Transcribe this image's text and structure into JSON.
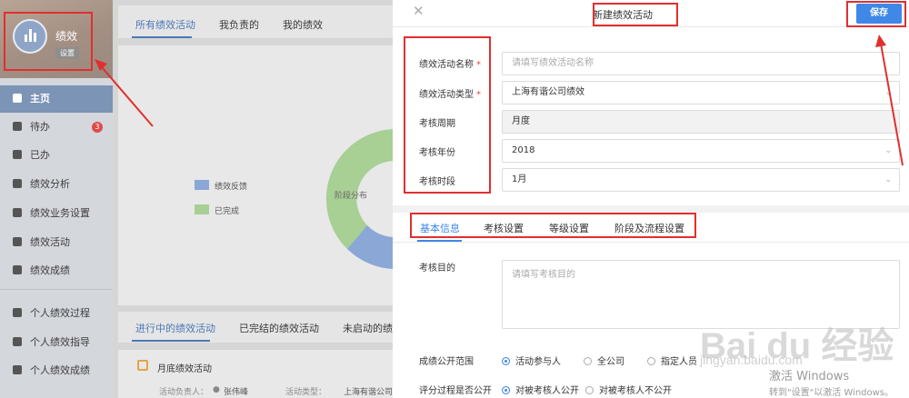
{
  "sidebar": {
    "app_name": "绩效",
    "settings_badge": "设置",
    "items": [
      {
        "label": "主页",
        "icon": "home-icon"
      },
      {
        "label": "待办",
        "icon": "chat-icon",
        "badge": "3"
      },
      {
        "label": "已办",
        "icon": "document-icon"
      },
      {
        "label": "绩效分析",
        "icon": "bar-chart-icon"
      },
      {
        "label": "绩效业务设置",
        "icon": "settings-icon"
      },
      {
        "label": "绩效活动",
        "icon": "pie-chart-icon"
      },
      {
        "label": "绩效成绩",
        "icon": "report-icon"
      },
      {
        "label": "个人绩效过程",
        "icon": "refresh-icon"
      },
      {
        "label": "个人绩效指导",
        "icon": "compass-icon"
      },
      {
        "label": "个人绩效成绩",
        "icon": "bar-chart-icon"
      }
    ]
  },
  "main": {
    "tabs": [
      "所有绩效活动",
      "我负责的",
      "我的绩效"
    ],
    "legend": [
      {
        "label": "绩效反馈",
        "color": "#8aa7d6"
      },
      {
        "label": "已完成",
        "color": "#a8cf94"
      }
    ],
    "donut_center": "阶段分布",
    "list_tabs": [
      "进行中的绩效活动",
      "已完结的绩效活动",
      "未启动的绩"
    ],
    "task": {
      "title": "月底绩效活动",
      "owner_label": "活动负责人：",
      "owner": "张伟峰",
      "type_label": "活动类型：",
      "type_value": "上海有谐公司"
    }
  },
  "panel": {
    "title": "新建绩效活动",
    "save_label": "保存",
    "close_icon": "close-icon",
    "fields": {
      "name": {
        "label": "绩效活动名称",
        "required": "*",
        "placeholder": "请填写绩效活动名称"
      },
      "type": {
        "label": "绩效活动类型",
        "required": "*",
        "value": "上海有谐公司绩效"
      },
      "cycle": {
        "label": "考核周期",
        "value": "月度"
      },
      "year": {
        "label": "考核年份",
        "value": "2018"
      },
      "period": {
        "label": "考核时段",
        "value": "1月"
      }
    },
    "tabs": [
      "基本信息",
      "考核设置",
      "等级设置",
      "阶段及流程设置"
    ],
    "purpose": {
      "label": "考核目的",
      "placeholder": "请填写考核目的"
    },
    "publish_scope": {
      "label": "成绩公开范围",
      "options": [
        "活动参与人",
        "全公司",
        "指定人员"
      ],
      "selected": "活动参与人"
    },
    "eval_public": {
      "label": "评分过程是否公开",
      "options": [
        "对被考核人公开",
        "对被考核人不公开"
      ],
      "selected": "对被考核人公开"
    }
  },
  "watermarks": {
    "baidu": "Bai du 经验",
    "url": "jingyan.baidu.com",
    "windows_line1": "激活 Windows",
    "windows_line2": "转到\"设置\"以激活 Windows。"
  },
  "colors": {
    "accent": "#3f88e8",
    "annotation_red": "#e02f2f",
    "required_red": "#e04b4b"
  }
}
